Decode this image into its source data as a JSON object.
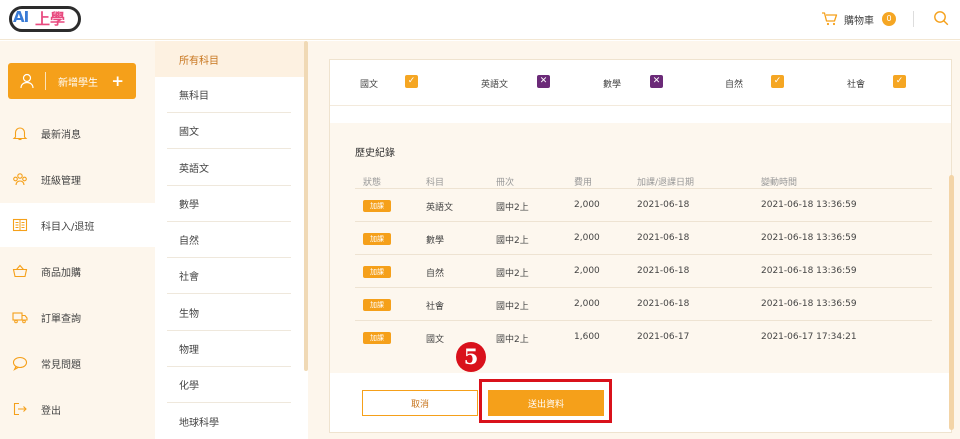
{
  "header": {
    "logo_text_ai": "AI",
    "logo_text_rest": "上學",
    "cart_label": "購物車",
    "cart_count": "0",
    "icons": {
      "cart": "cart-icon",
      "search": "search-icon"
    }
  },
  "sidebar": {
    "add_student_label": "新增學生",
    "add_student_plus": "+",
    "items": [
      {
        "label": "最新消息",
        "icon": "bell-icon"
      },
      {
        "label": "班級管理",
        "icon": "people-icon"
      },
      {
        "label": "科目入/退班",
        "icon": "book-icon",
        "active": true
      },
      {
        "label": "商品加購",
        "icon": "basket-icon"
      },
      {
        "label": "訂單查詢",
        "icon": "truck-icon"
      },
      {
        "label": "常見問題",
        "icon": "chat-icon"
      },
      {
        "label": "登出",
        "icon": "logout-icon"
      }
    ]
  },
  "subjects": [
    "所有科目",
    "無科目",
    "國文",
    "英語文",
    "數學",
    "自然",
    "社會",
    "生物",
    "物理",
    "化學",
    "地球科學"
  ],
  "selection": [
    {
      "label": "國文",
      "checked": true,
      "mark": "✓"
    },
    {
      "label": "英語文",
      "checked": false,
      "mark": "✕"
    },
    {
      "label": "數學",
      "checked": false,
      "mark": "✕"
    },
    {
      "label": "自然",
      "checked": true,
      "mark": "✓"
    },
    {
      "label": "社會",
      "checked": true,
      "mark": "✓"
    }
  ],
  "history": {
    "title": "歷史紀錄",
    "headers": [
      "狀態",
      "科目",
      "冊次",
      "費用",
      "加課/退課日期",
      "變動時間"
    ],
    "rows": [
      {
        "status": "加課",
        "subject": "英語文",
        "volume": "國中2上",
        "fee": "2,000",
        "date": "2021-06-18",
        "time": "2021-06-18 13:36:59"
      },
      {
        "status": "加課",
        "subject": "數學",
        "volume": "國中2上",
        "fee": "2,000",
        "date": "2021-06-18",
        "time": "2021-06-18 13:36:59"
      },
      {
        "status": "加課",
        "subject": "自然",
        "volume": "國中2上",
        "fee": "2,000",
        "date": "2021-06-18",
        "time": "2021-06-18 13:36:59"
      },
      {
        "status": "加課",
        "subject": "社會",
        "volume": "國中2上",
        "fee": "2,000",
        "date": "2021-06-18",
        "time": "2021-06-18 13:36:59"
      },
      {
        "status": "加課",
        "subject": "國文",
        "volume": "國中2上",
        "fee": "1,600",
        "date": "2021-06-17",
        "time": "2021-06-17 17:34:21"
      }
    ]
  },
  "actions": {
    "cancel_label": "取消",
    "submit_label": "送出資料",
    "step_marker": "5"
  },
  "colors": {
    "accent": "#f5a01a",
    "highlight": "#d9111b",
    "unchecked": "#6b2a78"
  }
}
